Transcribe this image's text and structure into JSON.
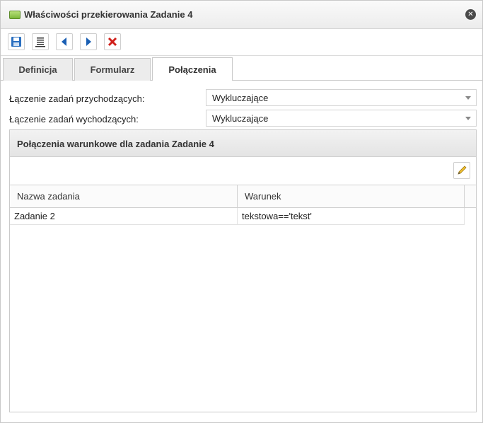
{
  "window": {
    "title": "Właściwości przekierowania Zadanie 4",
    "icon": "folder-green-icon",
    "close_icon": "close-icon"
  },
  "toolbar": {
    "buttons": [
      {
        "name": "save-button",
        "icon": "save-icon"
      },
      {
        "name": "properties-button",
        "icon": "text-lines-icon"
      },
      {
        "name": "previous-button",
        "icon": "arrow-left-icon"
      },
      {
        "name": "next-button",
        "icon": "arrow-right-icon"
      },
      {
        "name": "delete-button",
        "icon": "red-x-icon"
      }
    ]
  },
  "tabs": [
    {
      "label": "Definicja",
      "active": false
    },
    {
      "label": "Formularz",
      "active": false
    },
    {
      "label": "Połączenia",
      "active": true
    }
  ],
  "form": {
    "incoming_label": "Łączenie zadań przychodzących:",
    "incoming_value": "Wykluczające",
    "outgoing_label": "Łączenie zadań wychodzących:",
    "outgoing_value": "Wykluczające"
  },
  "panel": {
    "title": "Połączenia warunkowe dla zadania Zadanie 4",
    "edit_icon": "pencil-icon",
    "columns": [
      "Nazwa zadania",
      "Warunek"
    ],
    "rows": [
      {
        "task": "Zadanie 2",
        "condition": "tekstowa=='tekst'"
      }
    ]
  },
  "colors": {
    "accent_green": "#7cb83a",
    "nav_blue": "#1a5fb4",
    "delete_red": "#d0201a"
  }
}
